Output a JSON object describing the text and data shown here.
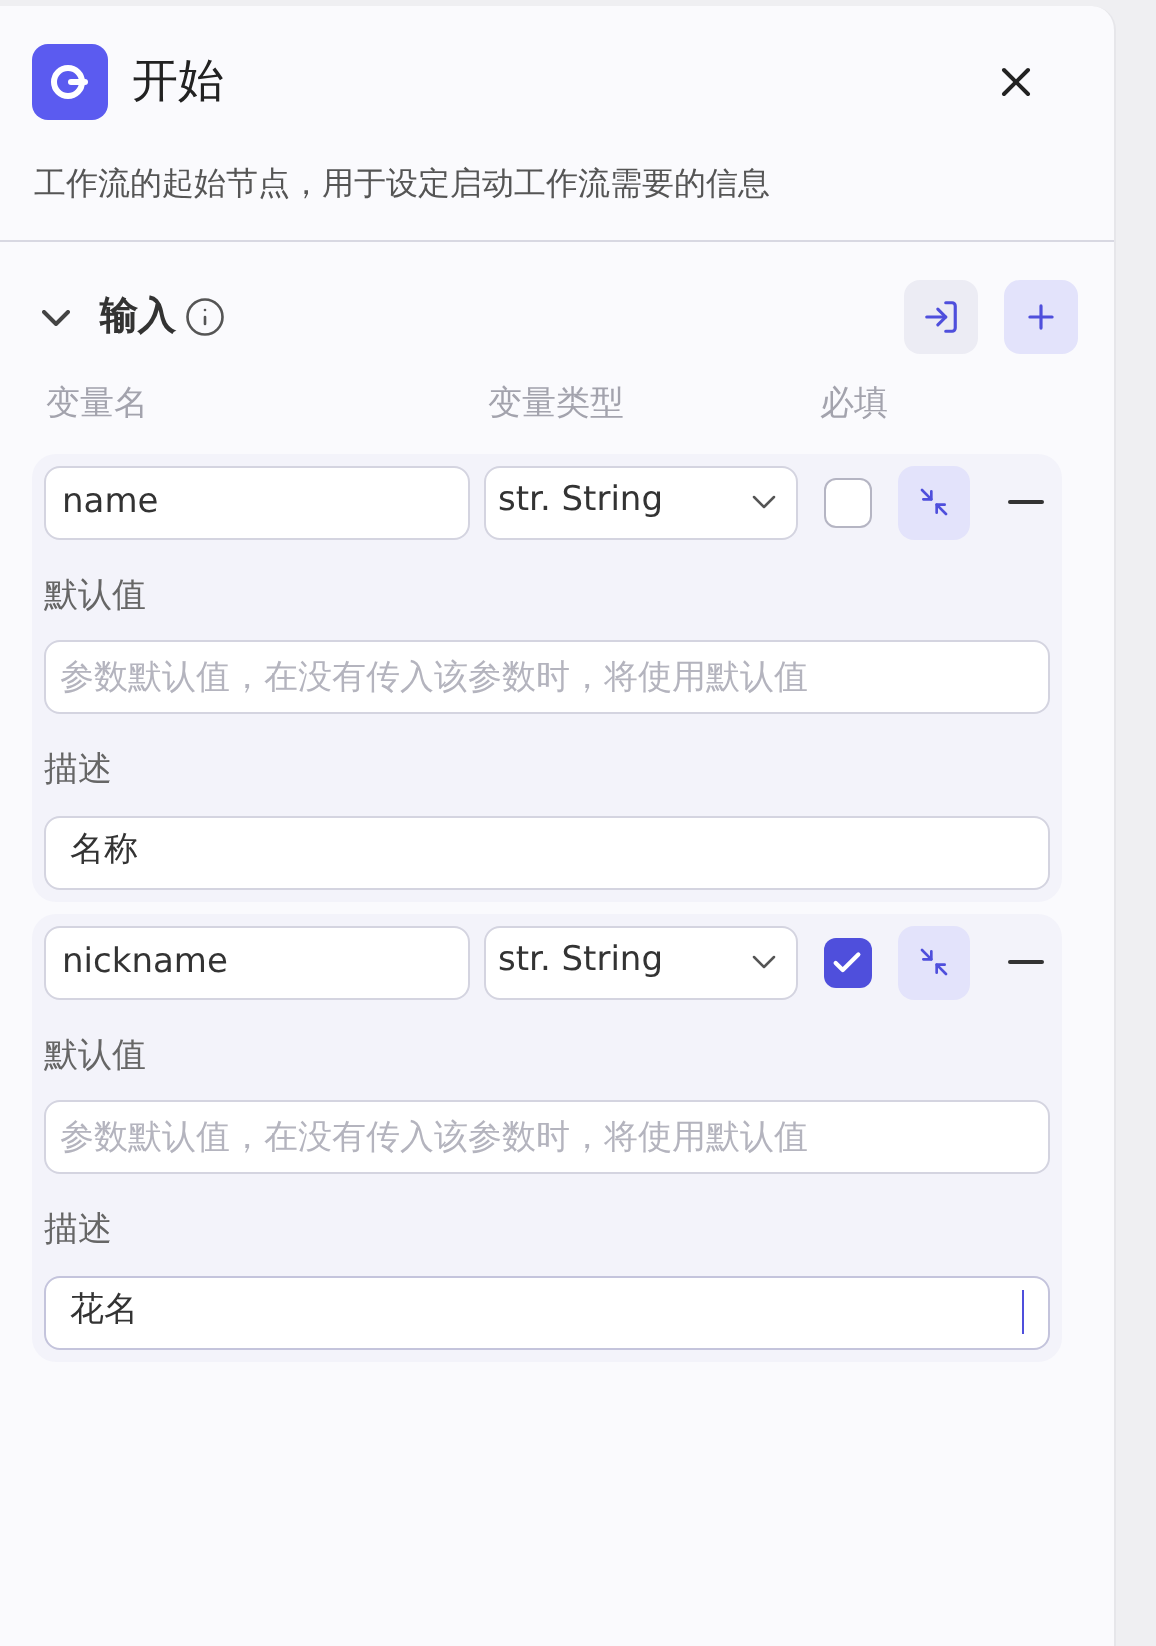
{
  "header": {
    "title": "开始",
    "description": "工作流的起始节点，用于设定启动工作流需要的信息"
  },
  "input_section": {
    "title": "输入",
    "expanded": true,
    "columns": [
      "变量名",
      "变量类型",
      "必填"
    ],
    "variables": [
      {
        "name": "name",
        "type": "str. String",
        "required": false,
        "default_label": "默认值",
        "default_placeholder": "参数默认值，在没有传入该参数时，将使用默认值",
        "description_label": "描述",
        "description": "名称",
        "focused": false
      },
      {
        "name": "nickname",
        "type": "str. String",
        "required": true,
        "default_label": "默认值",
        "default_placeholder": "参数默认值，在没有传入该参数时，将使用默认值",
        "description_label": "描述",
        "description": "花名",
        "focused": true
      }
    ]
  }
}
